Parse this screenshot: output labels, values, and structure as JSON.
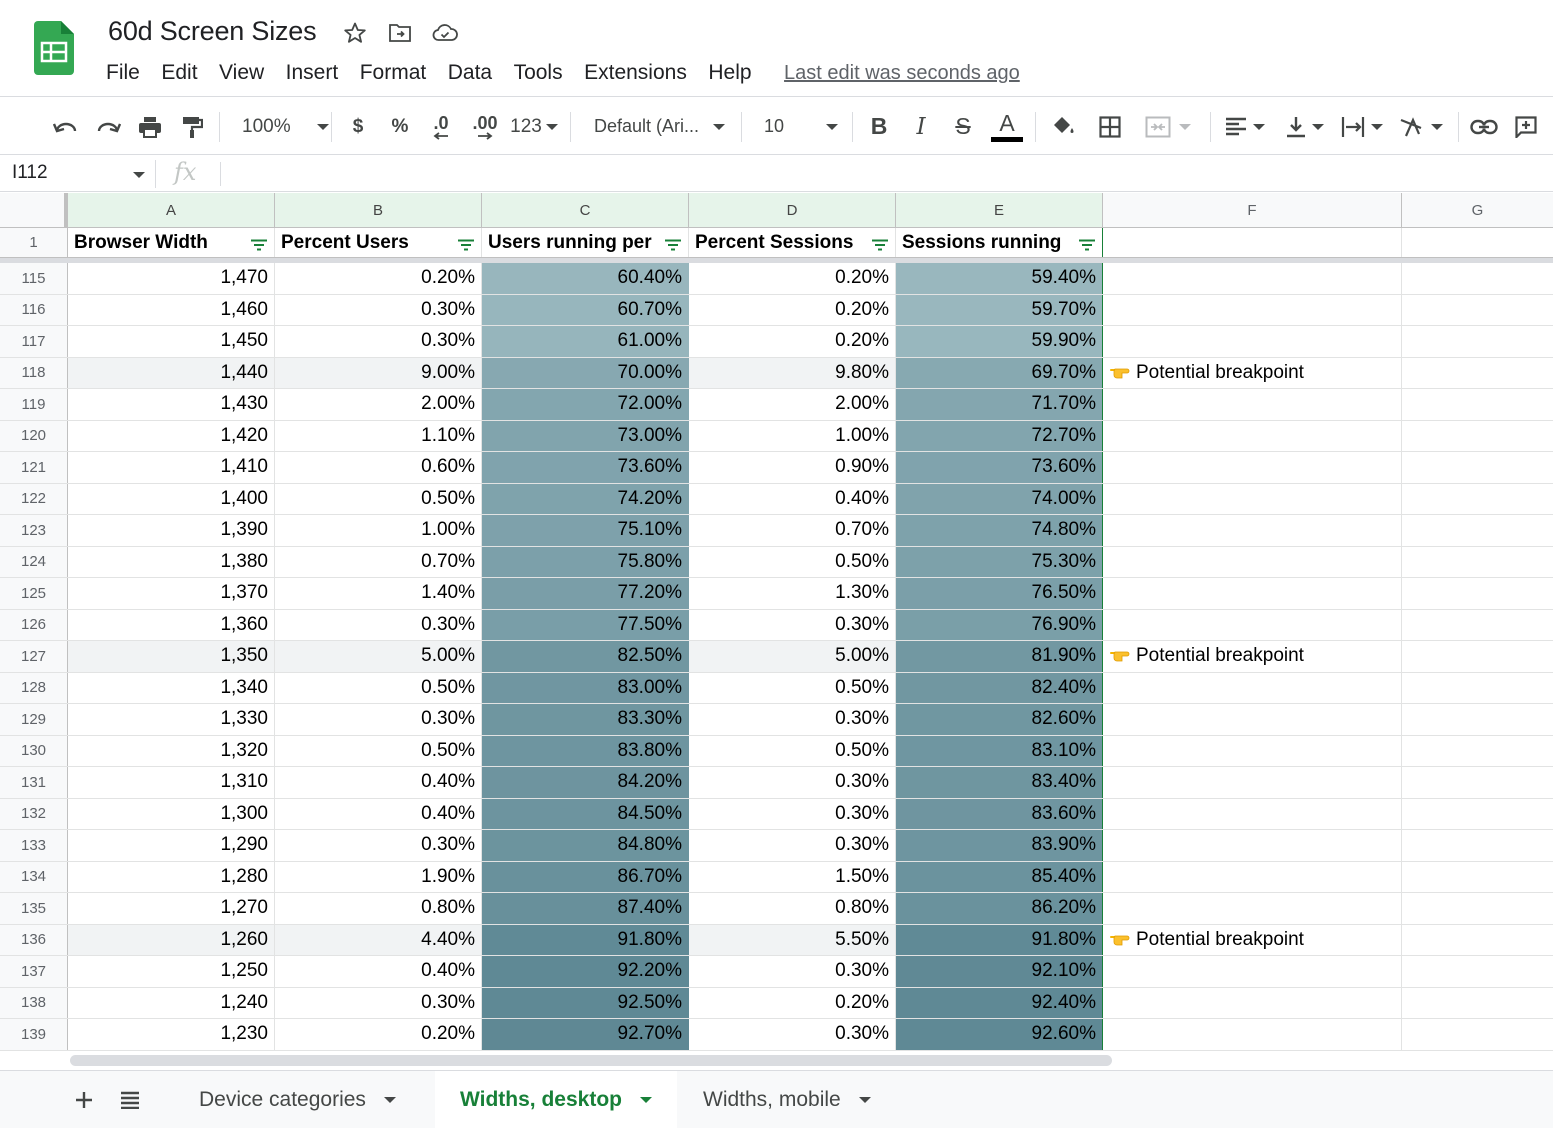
{
  "title": "60d Screen Sizes",
  "menu": [
    "File",
    "Edit",
    "View",
    "Insert",
    "Format",
    "Data",
    "Tools",
    "Extensions",
    "Help"
  ],
  "last_edit": "Last edit was seconds ago",
  "toolbar": {
    "zoom": "100%",
    "currency": "$",
    "percent": "%",
    "decrease_decimals": ".0",
    "increase_decimals": ".00",
    "more_formats": "123",
    "font": "Default (Ari...",
    "font_size": "10",
    "bold": "B",
    "italic": "I",
    "strike": "S",
    "text_color": "A"
  },
  "formula_bar": {
    "cell_ref": "I112",
    "fx": "fx",
    "value": ""
  },
  "columns": [
    "A",
    "B",
    "C",
    "D",
    "E",
    "F",
    "G"
  ],
  "header_row": {
    "number": "1",
    "cells": [
      "Browser Width",
      "Percent Users",
      "Users running per",
      "Percent Sessions",
      "Sessions running"
    ]
  },
  "rows": [
    {
      "n": "115",
      "a": "1,470",
      "b": "0.20%",
      "c": "60.40%",
      "d": "0.20%",
      "e": "59.40%",
      "f": ""
    },
    {
      "n": "116",
      "a": "1,460",
      "b": "0.30%",
      "c": "60.70%",
      "d": "0.20%",
      "e": "59.70%",
      "f": ""
    },
    {
      "n": "117",
      "a": "1,450",
      "b": "0.30%",
      "c": "61.00%",
      "d": "0.20%",
      "e": "59.90%",
      "f": ""
    },
    {
      "n": "118",
      "a": "1,440",
      "b": "9.00%",
      "c": "70.00%",
      "d": "9.80%",
      "e": "69.70%",
      "f": "Potential breakpoint"
    },
    {
      "n": "119",
      "a": "1,430",
      "b": "2.00%",
      "c": "72.00%",
      "d": "2.00%",
      "e": "71.70%",
      "f": ""
    },
    {
      "n": "120",
      "a": "1,420",
      "b": "1.10%",
      "c": "73.00%",
      "d": "1.00%",
      "e": "72.70%",
      "f": ""
    },
    {
      "n": "121",
      "a": "1,410",
      "b": "0.60%",
      "c": "73.60%",
      "d": "0.90%",
      "e": "73.60%",
      "f": ""
    },
    {
      "n": "122",
      "a": "1,400",
      "b": "0.50%",
      "c": "74.20%",
      "d": "0.40%",
      "e": "74.00%",
      "f": ""
    },
    {
      "n": "123",
      "a": "1,390",
      "b": "1.00%",
      "c": "75.10%",
      "d": "0.70%",
      "e": "74.80%",
      "f": ""
    },
    {
      "n": "124",
      "a": "1,380",
      "b": "0.70%",
      "c": "75.80%",
      "d": "0.50%",
      "e": "75.30%",
      "f": ""
    },
    {
      "n": "125",
      "a": "1,370",
      "b": "1.40%",
      "c": "77.20%",
      "d": "1.30%",
      "e": "76.50%",
      "f": ""
    },
    {
      "n": "126",
      "a": "1,360",
      "b": "0.30%",
      "c": "77.50%",
      "d": "0.30%",
      "e": "76.90%",
      "f": ""
    },
    {
      "n": "127",
      "a": "1,350",
      "b": "5.00%",
      "c": "82.50%",
      "d": "5.00%",
      "e": "81.90%",
      "f": "Potential breakpoint"
    },
    {
      "n": "128",
      "a": "1,340",
      "b": "0.50%",
      "c": "83.00%",
      "d": "0.50%",
      "e": "82.40%",
      "f": ""
    },
    {
      "n": "129",
      "a": "1,330",
      "b": "0.30%",
      "c": "83.30%",
      "d": "0.30%",
      "e": "82.60%",
      "f": ""
    },
    {
      "n": "130",
      "a": "1,320",
      "b": "0.50%",
      "c": "83.80%",
      "d": "0.50%",
      "e": "83.10%",
      "f": ""
    },
    {
      "n": "131",
      "a": "1,310",
      "b": "0.40%",
      "c": "84.20%",
      "d": "0.30%",
      "e": "83.40%",
      "f": ""
    },
    {
      "n": "132",
      "a": "1,300",
      "b": "0.40%",
      "c": "84.50%",
      "d": "0.30%",
      "e": "83.60%",
      "f": ""
    },
    {
      "n": "133",
      "a": "1,290",
      "b": "0.30%",
      "c": "84.80%",
      "d": "0.30%",
      "e": "83.90%",
      "f": ""
    },
    {
      "n": "134",
      "a": "1,280",
      "b": "1.90%",
      "c": "86.70%",
      "d": "1.50%",
      "e": "85.40%",
      "f": ""
    },
    {
      "n": "135",
      "a": "1,270",
      "b": "0.80%",
      "c": "87.40%",
      "d": "0.80%",
      "e": "86.20%",
      "f": ""
    },
    {
      "n": "136",
      "a": "1,260",
      "b": "4.40%",
      "c": "91.80%",
      "d": "5.50%",
      "e": "91.80%",
      "f": "Potential breakpoint"
    },
    {
      "n": "137",
      "a": "1,250",
      "b": "0.40%",
      "c": "92.20%",
      "d": "0.30%",
      "e": "92.10%",
      "f": ""
    },
    {
      "n": "138",
      "a": "1,240",
      "b": "0.30%",
      "c": "92.50%",
      "d": "0.20%",
      "e": "92.40%",
      "f": ""
    },
    {
      "n": "139",
      "a": "1,230",
      "b": "0.20%",
      "c": "92.70%",
      "d": "0.30%",
      "e": "92.60%",
      "f": ""
    }
  ],
  "sheets": [
    {
      "label": "Device categories",
      "active": false
    },
    {
      "label": "Widths, desktop",
      "active": true
    },
    {
      "label": "Widths, mobile",
      "active": false
    }
  ],
  "colors": {
    "brand_green": "#188038",
    "logo_green": "#34a853",
    "heat_low": "#9ab8bf",
    "heat_high": "#5e8894",
    "highlight_row": "#f1f3f4"
  }
}
